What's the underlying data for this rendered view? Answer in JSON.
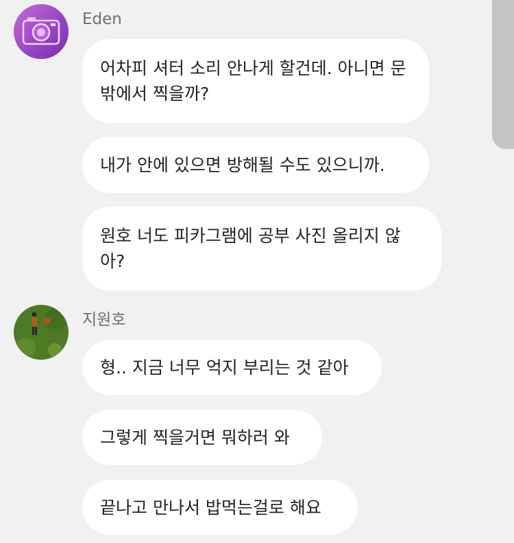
{
  "conversation": {
    "groups": [
      {
        "sender": "Eden",
        "avatar_icon": "camera-icon",
        "messages": [
          "어차피 셔터 소리 안나게 할건데. 아니면 문 밖에서 찍을까?",
          "내가 안에 있으면 방해될 수도 있으니까.",
          "원호 너도 피카그램에 공부 사진 올리지 않아?"
        ]
      },
      {
        "sender": "지원호",
        "avatar_icon": "person-on-grass-icon",
        "messages": [
          "형.. 지금 너무 억지 부리는 것 같아",
          "그렇게 찍을거면 뭐하러 와",
          "끝나고 만나서 밥먹는걸로 해요"
        ]
      }
    ]
  },
  "colors": {
    "background": "#f1f1f1",
    "bubble": "#ffffff",
    "text": "#222222",
    "sender_name": "#6f6f6f",
    "scrollbar": "#c4c4c4"
  }
}
